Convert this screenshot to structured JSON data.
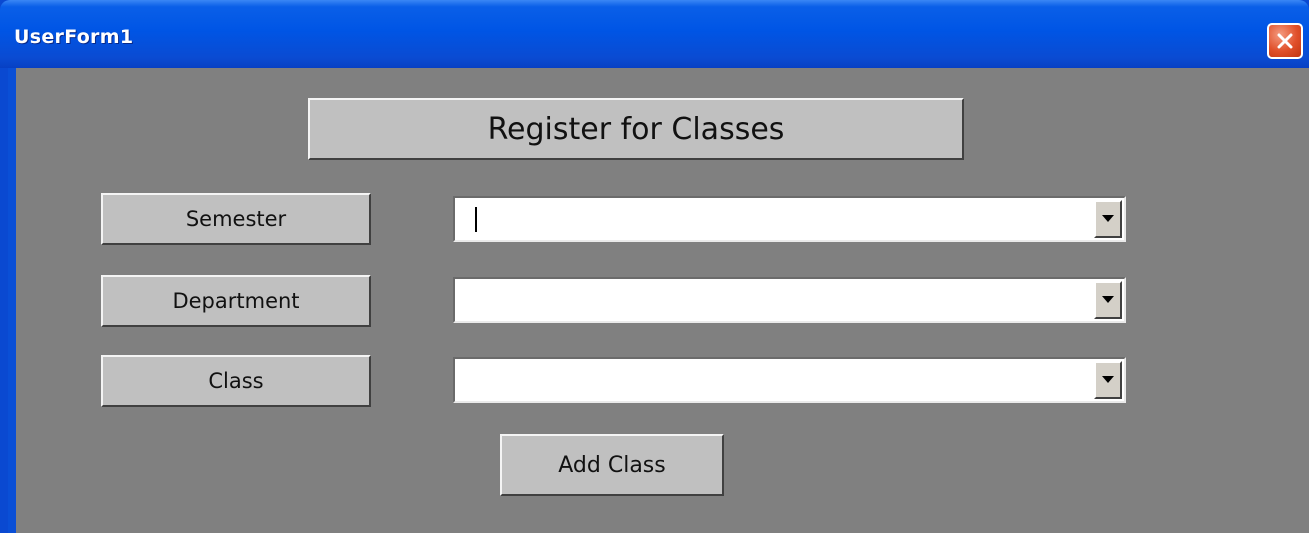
{
  "window": {
    "title": "UserForm1",
    "close_icon": "close-icon"
  },
  "form": {
    "heading": "Register for Classes",
    "fields": [
      {
        "label": "Semester",
        "value": ""
      },
      {
        "label": "Department",
        "value": ""
      },
      {
        "label": "Class",
        "value": ""
      }
    ],
    "add_button": "Add Class"
  },
  "colors": {
    "titlebar": "#0055e5",
    "client": "#808080",
    "control": "#c0c0c0",
    "close": "#e0502a"
  }
}
